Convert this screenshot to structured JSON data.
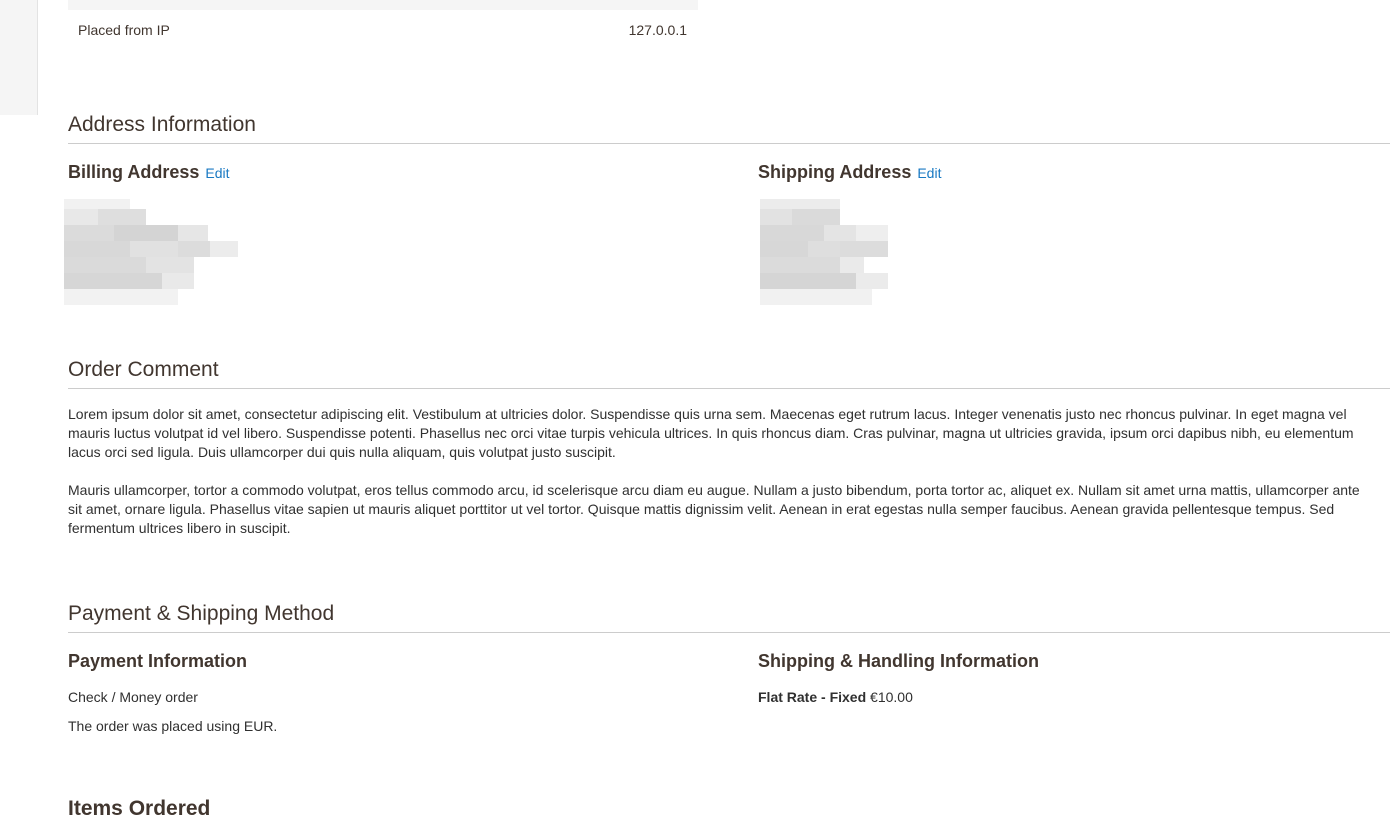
{
  "info": {
    "ip_label": "Placed from IP",
    "ip_value": "127.0.0.1"
  },
  "address": {
    "title": "Address Information",
    "billing_title": "Billing Address",
    "shipping_title": "Shipping Address",
    "edit_label": "Edit"
  },
  "comment": {
    "title": "Order Comment",
    "paragraphs": [
      "Lorem ipsum dolor sit amet, consectetur adipiscing elit. Vestibulum at ultricies dolor. Suspendisse quis urna sem. Maecenas eget rutrum lacus. Integer venenatis justo nec rhoncus pulvinar. In eget magna vel mauris luctus volutpat id vel libero. Suspendisse potenti. Phasellus nec orci vitae turpis vehicula ultrices. In quis rhoncus diam. Cras pulvinar, magna ut ultricies gravida, ipsum orci dapibus nibh, eu elementum lacus orci sed ligula. Duis ullamcorper dui quis nulla aliquam, quis volutpat justo suscipit.",
      "Mauris ullamcorper, tortor a commodo volutpat, eros tellus commodo arcu, id scelerisque arcu diam eu augue. Nullam a justo bibendum, porta tortor ac, aliquet ex. Nullam sit amet urna mattis, ullamcorper ante sit amet, ornare ligula. Phasellus vitae sapien ut mauris aliquet porttitor ut vel tortor. Quisque mattis dignissim velit. Aenean in erat egestas nulla semper faucibus. Aenean gravida pellentesque tempus. Sed fermentum ultrices libero in suscipit."
    ]
  },
  "payment": {
    "title": "Payment & Shipping Method",
    "payment_title": "Payment Information",
    "payment_method": "Check / Money order",
    "currency_note": "The order was placed using EUR.",
    "shipping_title": "Shipping & Handling Information",
    "shipping_method": "Flat Rate - Fixed",
    "shipping_price": "€10.00"
  },
  "next_section_title": "Items Ordered",
  "colors": {
    "link": "#1979c3",
    "heading": "#41362f",
    "divider": "#cccccc"
  }
}
